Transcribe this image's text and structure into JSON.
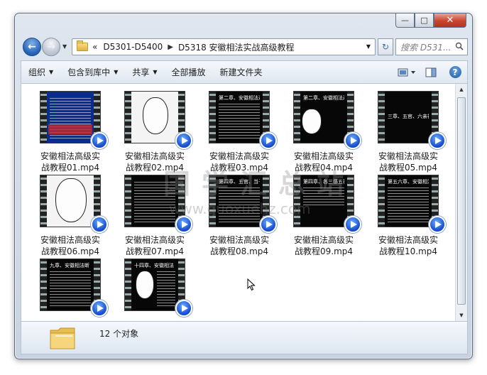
{
  "window": {
    "caption_minimize": "—",
    "caption_maximize": "□",
    "caption_close": "✕"
  },
  "nav": {
    "crumb_prefix": "«",
    "crumbs": [
      "D5301-D5400",
      "D5318 安徽相法实战高级教程"
    ],
    "search_placeholder": "搜索 D531...",
    "back_icon": "arrow-left-icon",
    "forward_icon": "arrow-right-icon",
    "refresh_icon": "refresh-icon"
  },
  "toolbar": {
    "organize": "组织",
    "include_in_library": "包含到库中",
    "share": "共享",
    "play_all": "全部播放",
    "new_folder": "新建文件夹"
  },
  "files": [
    {
      "line1": "安徽相法高级实",
      "line2": "战教程01.mp4",
      "thumb": "blue"
    },
    {
      "line1": "安徽相法高级实",
      "line2": "战教程02.mp4",
      "thumb": "white-face"
    },
    {
      "line1": "安徽相法高级实",
      "line2": "战教程03.mp4",
      "thumb": "black-text"
    },
    {
      "line1": "安徽相法高级实",
      "line2": "战教程04.mp4",
      "thumb": "black-face"
    },
    {
      "line1": "安徽相法高级实",
      "line2": "战教程05.mp4",
      "thumb": "black-title"
    },
    {
      "line1": "安徽相法高级实",
      "line2": "战教程06.mp4",
      "thumb": "white-face"
    },
    {
      "line1": "安徽相法高级实",
      "line2": "战教程07.mp4",
      "thumb": "black-text"
    },
    {
      "line1": "安徽相法高级实",
      "line2": "战教程08.mp4",
      "thumb": "black-text"
    },
    {
      "line1": "安徽相法高级实",
      "line2": "战教程09.mp4",
      "thumb": "black-text"
    },
    {
      "line1": "安徽相法高级实",
      "line2": "战教程10.mp4",
      "thumb": "black-text"
    },
    {
      "line1": "",
      "line2": "",
      "thumb": "black-text"
    },
    {
      "line1": "",
      "line2": "",
      "thumb": "black-face"
    }
  ],
  "thumb_captions": {
    "t3": "第二章、安徽相法过三关",
    "t4": "第二章、安徽相法过三关",
    "t5": "三章、五官、六亲神断",
    "t8": "第四章、五官、当子神",
    "t9": "第四章、各三感五神",
    "t10": "第五六章、安徽相法",
    "t11": "九章、安徽相法断",
    "t12": "十四章、安徽相法"
  },
  "watermark": {
    "text": "国学汇总站",
    "url": "www.guoxuehz.com"
  },
  "status": {
    "count": "12 个对象"
  },
  "colors": {
    "accent": "#2460b3",
    "close_button": "#c9452d"
  }
}
